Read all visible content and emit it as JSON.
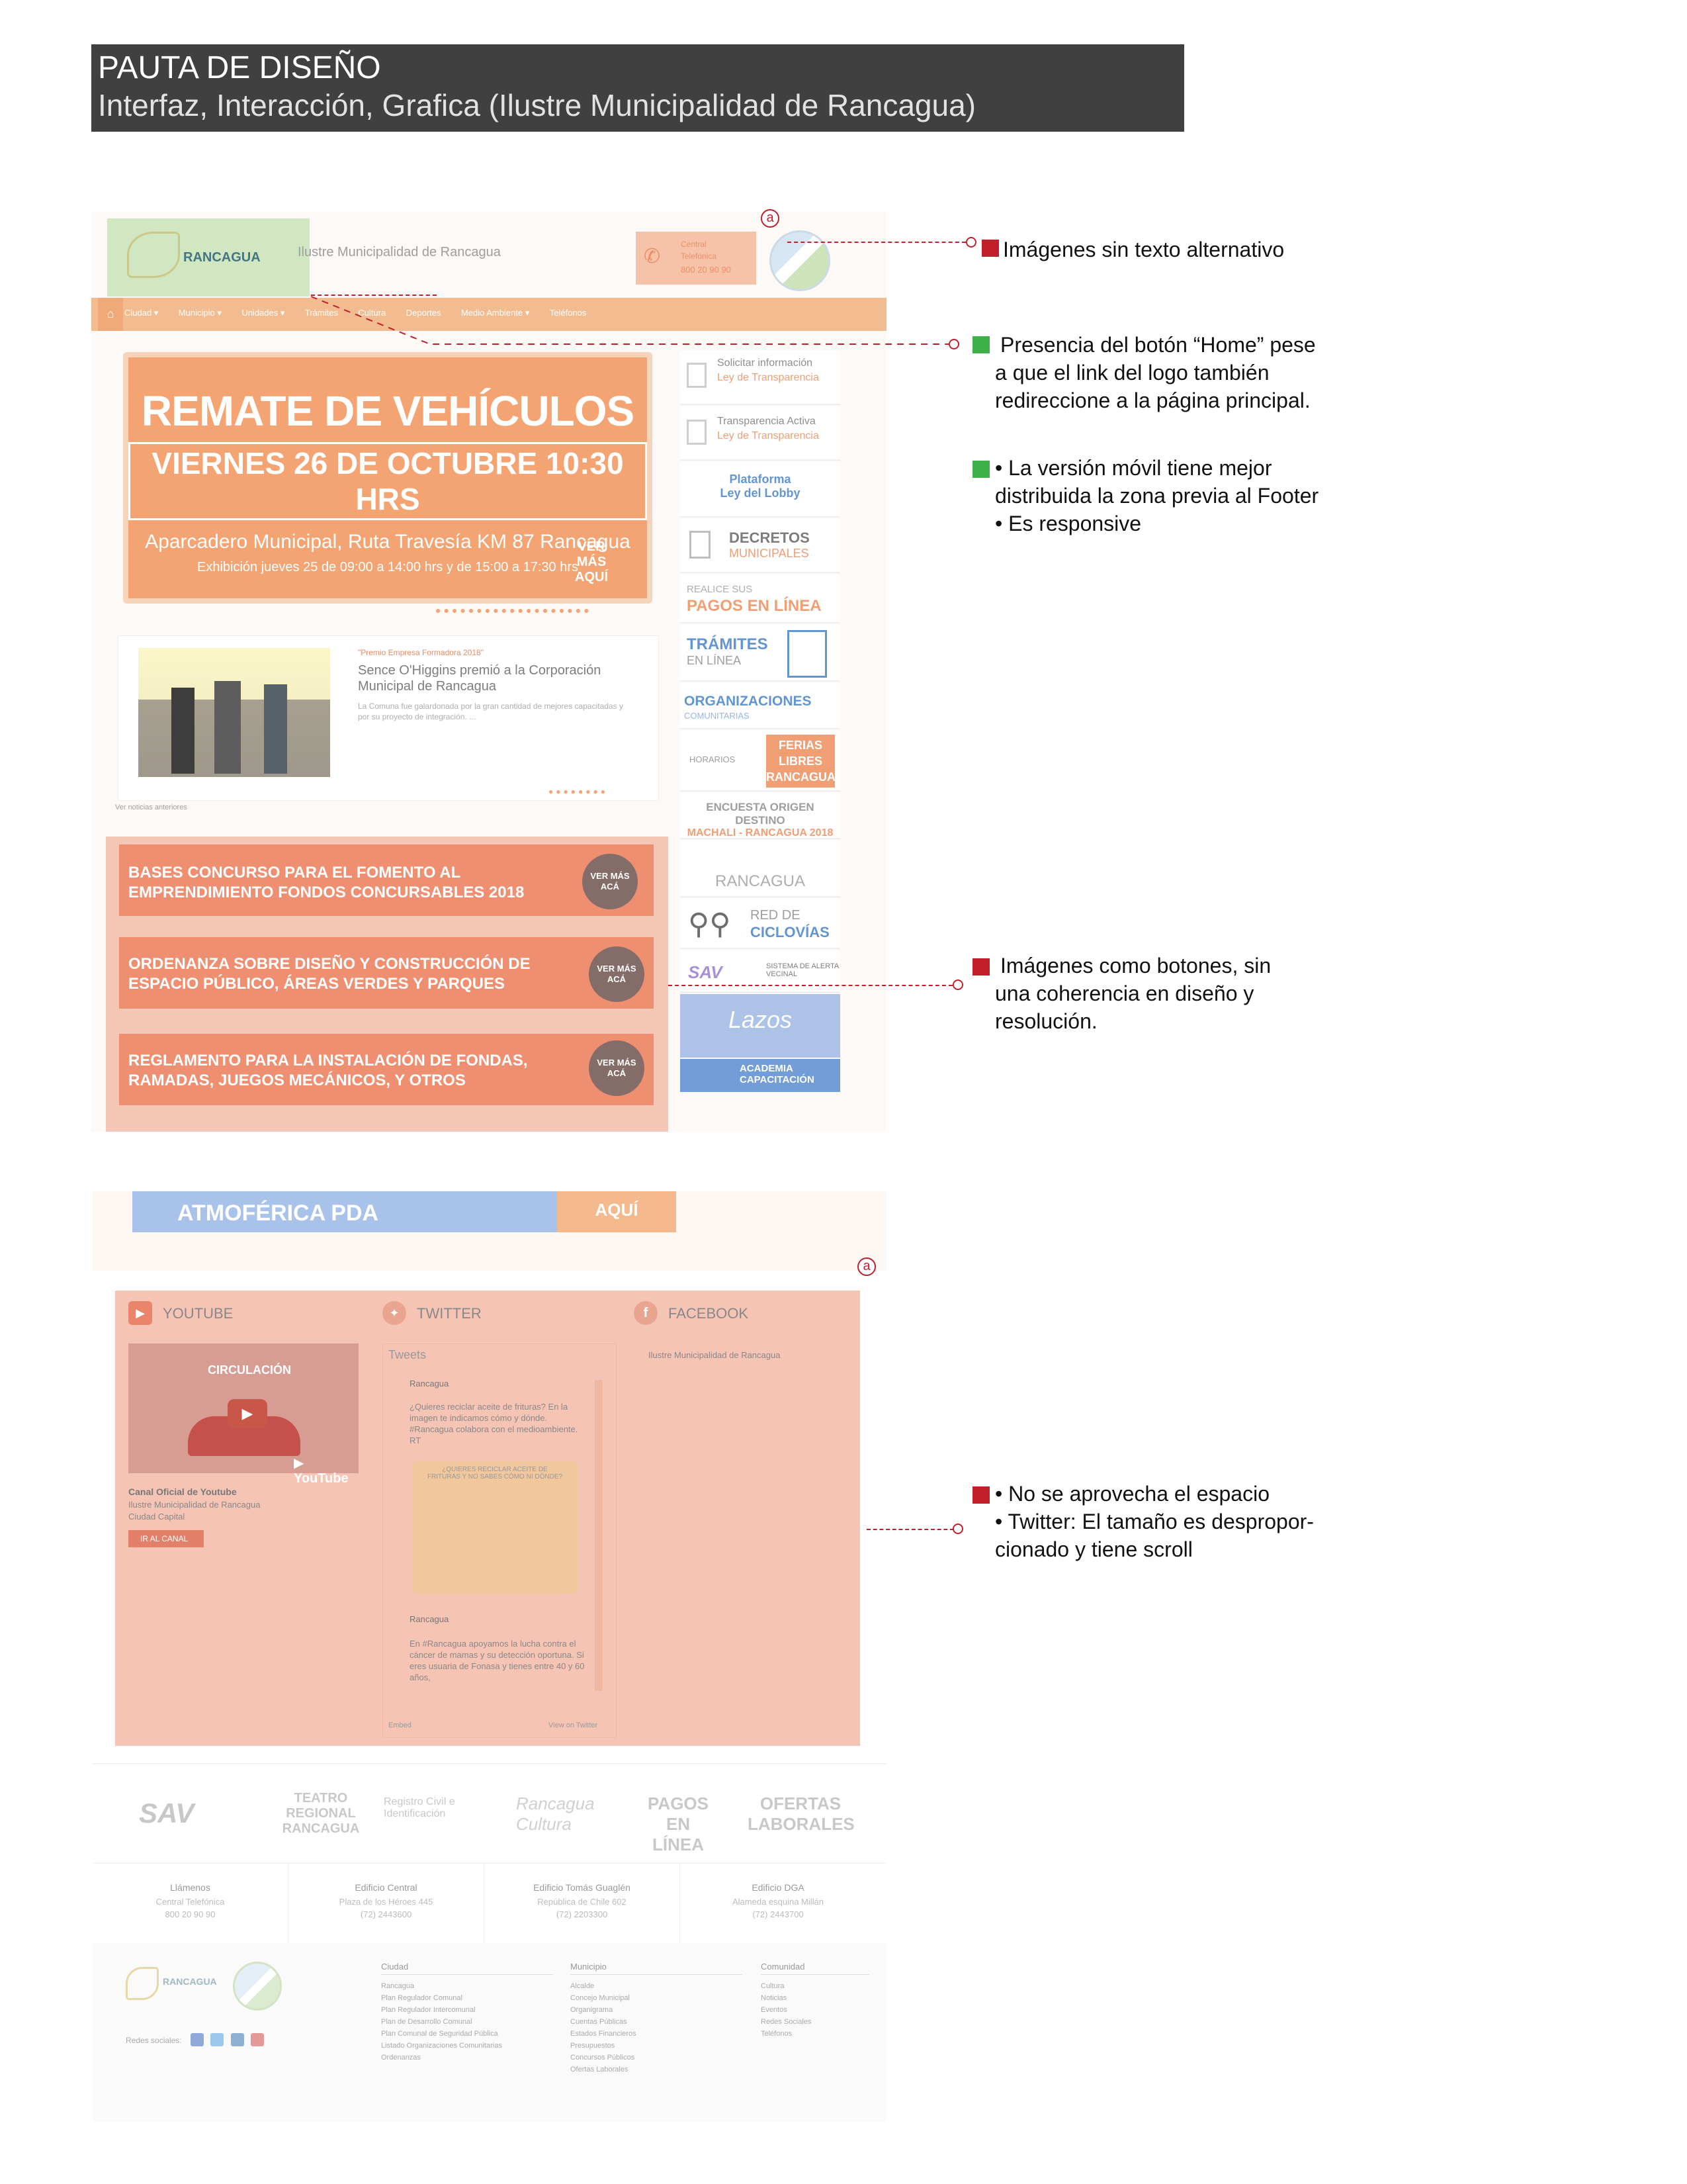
{
  "header": {
    "title": "PAUTA DE DISEÑO",
    "subtitle": "Interfaz, Interacción, Grafica (Ilustre Municipalidad de Rancagua)"
  },
  "site": {
    "logo_text": "RANCAGUA",
    "municipality_name": "Ilustre Municipalidad de Rancagua",
    "central": {
      "label": "Central",
      "sub": "Telefónica",
      "phone": "800 20 90 90"
    },
    "nav": [
      "Ciudad ▾",
      "Municipio ▾",
      "Unidades ▾",
      "Trámites",
      "Cultura",
      "Deportes",
      "Medio Ambiente ▾",
      "Teléfonos"
    ],
    "hero": {
      "title": "REMATE DE VEHÍCULOS",
      "date": "VIERNES 26 DE OCTUBRE 10:30 HRS",
      "location": "Aparcadero Municipal, Ruta Travesía KM 87 Rancagua",
      "exhibition": "Exhibición jueves 25 de 09:00 a 14:00 hrs y de 15:00 a 17:30 hrs",
      "cta": "VER MÁS AQUÍ"
    },
    "news": {
      "tag": "\"Premio Empresa Formadora 2018\"",
      "headline": "Sence O'Higgins premió a la Corporación Municipal de Rancagua",
      "excerpt": "La Comuna fue galardonada por la gran cantidad de mejores capacitadas y por su proyecto de integración. ...",
      "all_news": "Ver noticias anteriores"
    },
    "sidebar": [
      {
        "l1": "Solicitar información",
        "l2": "Ley de Transparencia"
      },
      {
        "l1": "Transparencia Activa",
        "l2": "Ley de Transparencia"
      },
      {
        "l1": "Plataforma",
        "l2": "Ley del Lobby"
      },
      {
        "l1": "DECRETOS",
        "l2": "MUNICIPALES"
      },
      {
        "l1": "REALICE SUS",
        "l2": "PAGOS EN LÍNEA"
      },
      {
        "l1": "TRÁMITES",
        "l2": "EN LÍNEA"
      },
      {
        "l1": "ORGANIZACIONES",
        "l2": "COMUNITARIAS"
      },
      {
        "l1": "HORARIOS",
        "l2": "FERIAS LIBRES RANCAGUA"
      },
      {
        "l1": "ENCUESTA ORIGEN DESTINO",
        "l2": "MACHALI - RANCAGUA 2018"
      },
      {
        "l1": "RANCAGUA",
        "l2": ""
      },
      {
        "l1": "RED DE",
        "l2": "CICLOVÍAS"
      },
      {
        "l1": "SAV",
        "l2": "SISTEMA DE ALERTA VECINAL"
      },
      {
        "l1": "Lazos",
        "l2": ""
      },
      {
        "l1": "ACADEMIA",
        "l2": "CAPACITACIÓN"
      }
    ],
    "banners": [
      {
        "text": "BASES CONCURSO PARA EL FOMENTO AL EMPRENDIMIENTO FONDOS CONCURSABLES 2018",
        "cta": "VER MÁS ACÁ"
      },
      {
        "text": "ORDENANZA SOBRE DISEÑO Y CONSTRUCCIÓN DE ESPACIO PÚBLICO, ÁREAS VERDES Y PARQUES",
        "cta": "VER MÁS ACÁ"
      },
      {
        "text": "REGLAMENTO PARA LA INSTALACIÓN DE FONDAS, RAMADAS, JUEGOS MECÁNICOS, Y OTROS",
        "cta": "VER MÁS ACÁ"
      }
    ],
    "pda": {
      "text": "ATMOFÉRICA PDA",
      "cta": "AQUÍ"
    },
    "social": {
      "youtube": "YOUTUBE",
      "twitter": "TWITTER",
      "facebook": "FACEBOOK",
      "video_title": "CIRCULACIÓN",
      "yt_channel": "Canal Oficial de Youtube",
      "yt_sub1": "Ilustre Municipalidad de Rancagua",
      "yt_sub2": "Ciudad Capital",
      "yt_btn": "IR AL CANAL",
      "tweets_head": "Tweets",
      "tweet1_user": "Rancagua",
      "tweet1_text": "¿Quieres reciclar aceite de frituras? En la imagen te indicamos cómo y dónde. #Rancagua colabora con el medioambiente. RT",
      "tweet_img_text": "¿QUIERES RECICLAR ACEITE DE FRITURAS Y NO SABES CÓMO NI DÓNDE?",
      "tweet2_user": "Rancagua",
      "tweet2_text": "En #Rancagua apoyamos la lucha contra el cáncer de mamas y su detección oportuna. Si eres usuaria de Fonasa y tienes entre 40 y 60 años,",
      "embed": "Embed",
      "view_on": "View on Twitter",
      "fb_name": "Ilustre Municipalidad de Rancagua"
    },
    "partners": [
      "SAV",
      "TEATRO REGIONAL RANCAGUA",
      "Registro Civil e Identificación",
      "Rancagua Cultura",
      "PAGOS EN LÍNEA",
      "OFERTAS LABORALES"
    ],
    "contacts": [
      {
        "t": "Llámenos",
        "a": "Central Telefónica",
        "p": "800 20 90 90"
      },
      {
        "t": "Edificio Central",
        "a": "Plaza de los Héroes 445",
        "p": "(72) 2443600"
      },
      {
        "t": "Edificio Tomás Guaglén",
        "a": "República de Chile 602",
        "p": "(72) 2203300"
      },
      {
        "t": "Edificio DGA",
        "a": "Alameda esquina Millán",
        "p": "(72) 2443700"
      }
    ],
    "footer": {
      "social_label": "Redes sociales:",
      "cols": [
        {
          "title": "Ciudad",
          "items": [
            "Rancagua",
            "Plan Regulador Comunal",
            "Plan Regulador Intercomunal",
            "Plan de Desarrollo Comunal",
            "Plan Comunal de Seguridad Pública",
            "Listado Organizaciones Comunitarias",
            "Ordenanzas"
          ]
        },
        {
          "title": "Municipio",
          "items": [
            "Alcalde",
            "Concejo Municipal",
            "Organigrama",
            "Cuentas Públicas",
            "Estados Financieros",
            "Presupuestos",
            "Concursos Públicos",
            "Ofertas Laborales"
          ]
        },
        {
          "title": "Comunidad",
          "items": [
            "Cultura",
            "Noticias",
            "Eventos",
            "Redes Sociales",
            "Teléfonos"
          ]
        }
      ]
    }
  },
  "annotations": [
    {
      "color": "#c1202b",
      "text": "Imágenes sin texto alternativo"
    },
    {
      "color": "#3faf49",
      "lines": [
        "Presencia del botón “Home” pese",
        "a que el link del logo también",
        "redireccione a la página principal."
      ]
    },
    {
      "color": "#3faf49",
      "lines": [
        "• La versión móvil tiene mejor",
        "distribuida la zona previa al Footer",
        "• Es responsive"
      ]
    },
    {
      "color": "#c1202b",
      "lines": [
        "Imágenes como botones, sin",
        "una coherencia en diseño y",
        "resolución."
      ]
    },
    {
      "color": "#c1202b",
      "lines": [
        "• No se aprovecha el espacio",
        "• Twitter: El tamaño es despropor-",
        "cionado y tiene scroll"
      ]
    }
  ],
  "markers": [
    "a",
    "a"
  ]
}
